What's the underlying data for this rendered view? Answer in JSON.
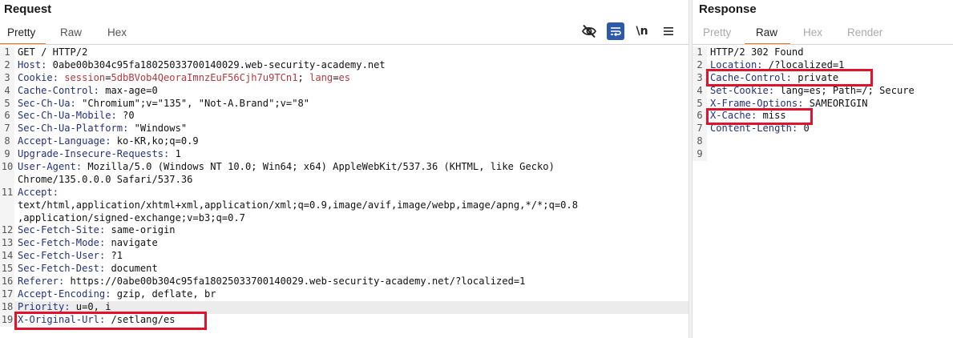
{
  "request": {
    "title": "Request",
    "tabs": [
      "Pretty",
      "Raw",
      "Hex"
    ],
    "active_tab": "Pretty",
    "toolbar": {
      "hide_icon": "eye-slash-icon",
      "wrap_icon": "wrap-text-icon",
      "newline_label": "\\n",
      "menu_icon": "hamburger-menu-icon"
    },
    "lines": [
      {
        "n": "1",
        "text": "GET / HTTP/2"
      },
      {
        "n": "2",
        "key": "Host",
        "value": " 0abe00b304c95fa18025033700140029.web-security-academy.net"
      },
      {
        "n": "3",
        "key": "Cookie",
        "cookie_name": "session",
        "cookie_value": "5dbBVob4QeoraImnzEuF56Cjh7u9TCn1",
        "cookie_name2": "lang",
        "cookie_value2": "es"
      },
      {
        "n": "4",
        "key": "Cache-Control",
        "value": " max-age=0"
      },
      {
        "n": "5",
        "key": "Sec-Ch-Ua",
        "value": " \"Chromium\";v=\"135\", \"Not-A.Brand\";v=\"8\""
      },
      {
        "n": "6",
        "key": "Sec-Ch-Ua-Mobile",
        "value": " ?0"
      },
      {
        "n": "7",
        "key": "Sec-Ch-Ua-Platform",
        "value": " \"Windows\""
      },
      {
        "n": "8",
        "key": "Accept-Language",
        "value": " ko-KR,ko;q=0.9"
      },
      {
        "n": "9",
        "key": "Upgrade-Insecure-Requests",
        "value": " 1"
      },
      {
        "n": "10",
        "key": "User-Agent",
        "value": " Mozilla/5.0 (Windows NT 10.0; Win64; x64) AppleWebKit/537.36 (KHTML, like Gecko)"
      },
      {
        "n": "",
        "text": "Chrome/135.0.0.0 Safari/537.36"
      },
      {
        "n": "11",
        "key": "Accept",
        "value": ""
      },
      {
        "n": "",
        "text": "text/html,application/xhtml+xml,application/xml;q=0.9,image/avif,image/webp,image/apng,*/*;q=0.8"
      },
      {
        "n": "",
        "text": ",application/signed-exchange;v=b3;q=0.7"
      },
      {
        "n": "12",
        "key": "Sec-Fetch-Site",
        "value": " same-origin"
      },
      {
        "n": "13",
        "key": "Sec-Fetch-Mode",
        "value": " navigate"
      },
      {
        "n": "14",
        "key": "Sec-Fetch-User",
        "value": " ?1"
      },
      {
        "n": "15",
        "key": "Sec-Fetch-Dest",
        "value": " document"
      },
      {
        "n": "16",
        "key": "Referer",
        "value": " https://0abe00b304c95fa18025033700140029.web-security-academy.net/?localized=1"
      },
      {
        "n": "17",
        "key": "Accept-Encoding",
        "value": " gzip, deflate, br"
      },
      {
        "n": "18",
        "key": "Priority",
        "value": " u=0, i",
        "highlight": true
      },
      {
        "n": "19",
        "key": "X-Original-Url",
        "value": " /setlang/es"
      }
    ]
  },
  "response": {
    "title": "Response",
    "tabs": [
      "Pretty",
      "Raw",
      "Hex",
      "Render"
    ],
    "active_tab": "Raw",
    "lines": [
      {
        "n": "1",
        "text": "HTTP/2 302 Found"
      },
      {
        "n": "2",
        "key": "Location",
        "value": " /?localized=1"
      },
      {
        "n": "3",
        "key": "Cache-Control",
        "value": " private"
      },
      {
        "n": "4",
        "key": "Set-Cookie",
        "value": " lang=es; Path=/; Secure"
      },
      {
        "n": "5",
        "key": "X-Frame-Options",
        "value": " SAMEORIGIN"
      },
      {
        "n": "6",
        "key": "X-Cache",
        "value": " miss"
      },
      {
        "n": "7",
        "key": "Content-Length",
        "value": " 0"
      },
      {
        "n": "8",
        "text": ""
      },
      {
        "n": "9",
        "text": ""
      }
    ]
  },
  "colors": {
    "accent": "#e8731d",
    "header_key": "#22307d",
    "cookie": "#b5373b",
    "annotation_box": "#e3122b"
  }
}
